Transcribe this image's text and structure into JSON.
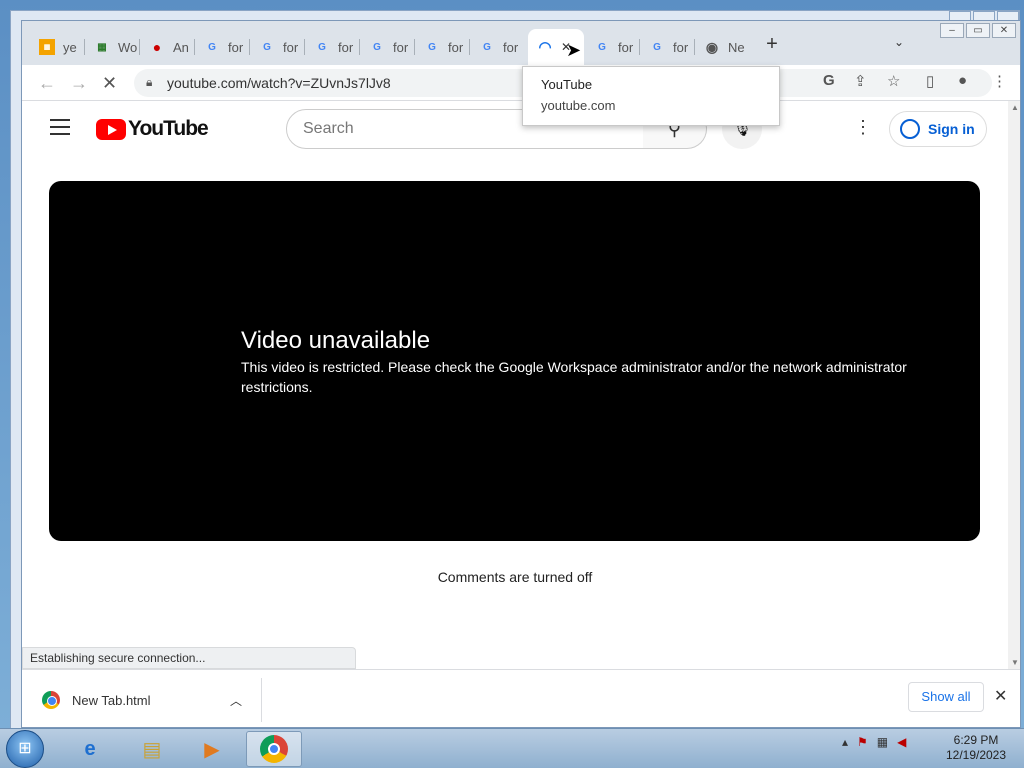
{
  "browser": {
    "tabs": [
      {
        "label": "ye",
        "icon": "yellow-app-icon"
      },
      {
        "label": "Wo",
        "icon": "grid-icon"
      },
      {
        "label": "An",
        "icon": "among-us-icon"
      },
      {
        "label": "for",
        "icon": "google-icon"
      },
      {
        "label": "for",
        "icon": "google-icon"
      },
      {
        "label": "for",
        "icon": "google-icon"
      },
      {
        "label": "for",
        "icon": "google-icon"
      },
      {
        "label": "for",
        "icon": "google-icon"
      },
      {
        "label": "for",
        "icon": "google-icon"
      },
      {
        "label": "",
        "icon": "loading-spinner-icon"
      },
      {
        "label": "for",
        "icon": "google-icon"
      },
      {
        "label": "for",
        "icon": "google-icon"
      },
      {
        "label": "Ne",
        "icon": "chrome-icon"
      }
    ],
    "new_tab": "+",
    "url": "youtube.com/watch?v=ZUvnJs7lJv8",
    "tooltip": {
      "title": "YouTube",
      "domain": "youtube.com"
    }
  },
  "youtube": {
    "logo_text": "YouTube",
    "search_placeholder": "Search",
    "sign_in": "Sign in",
    "error_title": "Video unavailable",
    "error_message": "This video is restricted. Please check the Google Workspace administrator and/or the network administrator restrictions.",
    "comments": "Comments are turned off"
  },
  "status_text": "Establishing secure connection...",
  "downloads": {
    "file": "New Tab.html",
    "show_all": "Show all"
  },
  "taskbar": {
    "time": "6:29 PM",
    "date": "12/19/2023"
  },
  "colors": {
    "youtube_red": "#ff0000",
    "signin_blue": "#065fd4",
    "link_blue": "#1a73e8"
  }
}
